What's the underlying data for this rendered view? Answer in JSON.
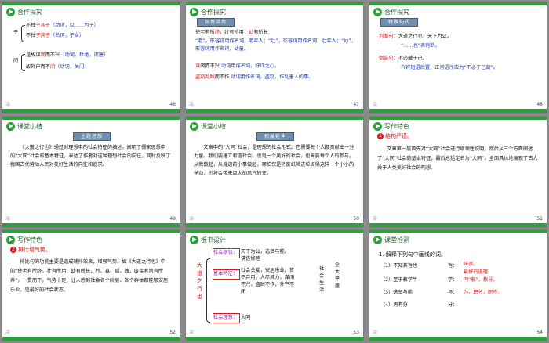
{
  "slides": [
    {
      "page": "46",
      "header": "合作探究",
      "lines": [
        {
          "pre": "子",
          "a": "不独",
          "b": "子其子",
          "c": "（动词，以……为子）"
        },
        {
          "a": "不独",
          "b": "子其子",
          "c": "（名词，子女）"
        },
        {
          "pre": "闭",
          "a": "是故谋",
          "b": "闭",
          "m": "而不兴",
          "c": "（动词，杜绝，闭塞）"
        },
        {
          "a": "故外户而不",
          "b": "闭",
          "c": "（动词，关门）"
        }
      ]
    },
    {
      "page": "47",
      "header": "合作探究",
      "badge": "词类活用",
      "lines": [
        {
          "t1": "使老有所",
          "r1": "终",
          "t2": "，壮有所用，",
          "r2": "幼",
          "t3": "有所长"
        },
        {
          "b": "“老”，形容词用作名词，老年人；“壮”，形容词用作名词，壮年人；“幼”，形容词用作名词，幼童。"
        },
        {
          "r": "谋",
          "t": "闭而不兴",
          "b": "动词用作名词，奸诈之心。"
        },
        {
          "r": "盗窃乱贼",
          "t": "而不作",
          "b": "动词用作名词，盗窃，作乱害人的事。"
        }
      ]
    },
    {
      "page": "48",
      "header": "合作探究",
      "badge": "特殊句式",
      "lines": [
        {
          "r": "判断句：",
          "t": "大道之行也，天下为公。"
        },
        {
          "b": "“……也”表判断。"
        },
        {
          "r": "倒装句：",
          "t": "不必藏于己。"
        },
        {
          "b": "介宾短语后置，正常语序应为“不必于己藏”。"
        }
      ]
    },
    {
      "page": "49",
      "header": "课堂小结",
      "badge": "主题思想",
      "para": "《大道之行也》通过对理想中的社会特征的描述，阐明了儒家思想中的“大同”社会的基本特征，表达了作者对这种理想社会的向往，同时反映了我国古代劳动人民对美好生活的向往和追求。"
    },
    {
      "page": "50",
      "header": "课堂小结",
      "badge": "拓展延伸",
      "para": "文章中的“大同”社会，是理想的社会形式。它需要每个人都贡献出一分力量。我们要建立和谐社会，也是一个美好的社会，也需要每个人的参与。从我做起，从身边的小事做起，哪怕仅是将废纸捡进垃圾桶这样一个小小的举动，也将会带来巨大的风气转变。"
    },
    {
      "page": "51",
      "header": "写作特色",
      "numlabel": "1",
      "sub": "结构严谨。",
      "para": "文章第一层首先对“大同”社会进行纲领性说明，然后从三个方面阐述了“大同”社会的基本特征，最后总括定名为“大同”。全面具体地展现了古人关于人类美好社会的构想。"
    },
    {
      "page": "52",
      "header": "写作特色",
      "numlabel": "2",
      "sub": "排比增气势。",
      "para1": "排比句的功能主要是造成铺排效果，增强气势。如《大道之行也》中的“使老有所终，壮有所用，幼有所长，矜、寡、孤、独、废疾者皆有所养”，一贯而下，气势十足，让人感到社会各个阶层、各个群体都能够安居乐业，是最好的社会状态。"
    },
    {
      "page": "53",
      "header": "板书设计",
      "vert": "大道之行也",
      "rows": [
        {
          "k": "社会纲领：",
          "v": "天下为公，选贤与能，讲信修睦"
        },
        {
          "k": "基本特征：",
          "v": "社会关爱，安居乐业，货不弃用，人尽其力，谋闭不兴，盗贼不作，外户不闭"
        },
        {
          "k": "社会理想：",
          "v": "大同"
        }
      ],
      "right": [
        "社",
        "会",
        "生",
        "活"
      ],
      "right2": "全太平盛"
    },
    {
      "page": "54",
      "header": "课堂检测",
      "q": "1. 解释下列句中画线的词。",
      "items": [
        {
          "n": "（1）",
          "t": "不知其旨也",
          "k": "旨：",
          "a": "味美。"
        },
        {
          "n": "",
          "t": "",
          "k": "",
          "a": "最好的道理。"
        },
        {
          "n": "（2）",
          "t": "至于教学半",
          "k": "学：",
          "a": "同“斅”，教导。"
        },
        {
          "n": "（3）",
          "t": "选贤与能",
          "k": "与：",
          "a": "为，职分，职守。"
        },
        {
          "n": "（4）",
          "t": "男有分",
          "k": "分：",
          "a": ""
        }
      ]
    }
  ]
}
